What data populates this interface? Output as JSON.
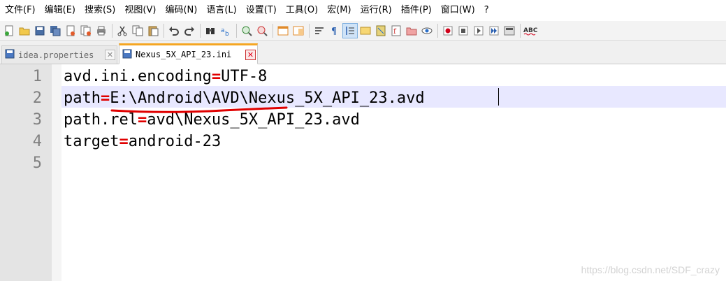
{
  "menubar": {
    "items": [
      "文件(F)",
      "编辑(E)",
      "搜索(S)",
      "视图(V)",
      "编码(N)",
      "语言(L)",
      "设置(T)",
      "工具(O)",
      "宏(M)",
      "运行(R)",
      "插件(P)",
      "窗口(W)",
      "?"
    ]
  },
  "tabs": {
    "inactive_label": "idea.properties",
    "active_label": "Nexus_5X_API_23.ini",
    "close_glyph": "✕"
  },
  "editor": {
    "line_numbers": [
      "1",
      "2",
      "3",
      "4",
      "5"
    ],
    "lines": [
      {
        "key": "avd.ini.encoding",
        "op": "=",
        "value": "UTF-8"
      },
      {
        "key": "path",
        "op": "=",
        "value": "E:\\Android\\AVD\\Nexus_5X_API_23.avd"
      },
      {
        "key": "path.rel",
        "op": "=",
        "value": "avd\\Nexus_5X_API_23.avd"
      },
      {
        "key": "target",
        "op": "=",
        "value": "android-23"
      }
    ],
    "current_line": 2
  },
  "colors": {
    "operator": "#e00000",
    "annotation": "#e00000",
    "current_line_bg": "#e8e8ff",
    "active_tab_accent": "#f5a623"
  },
  "watermark": "https://blog.csdn.net/SDF_crazy"
}
